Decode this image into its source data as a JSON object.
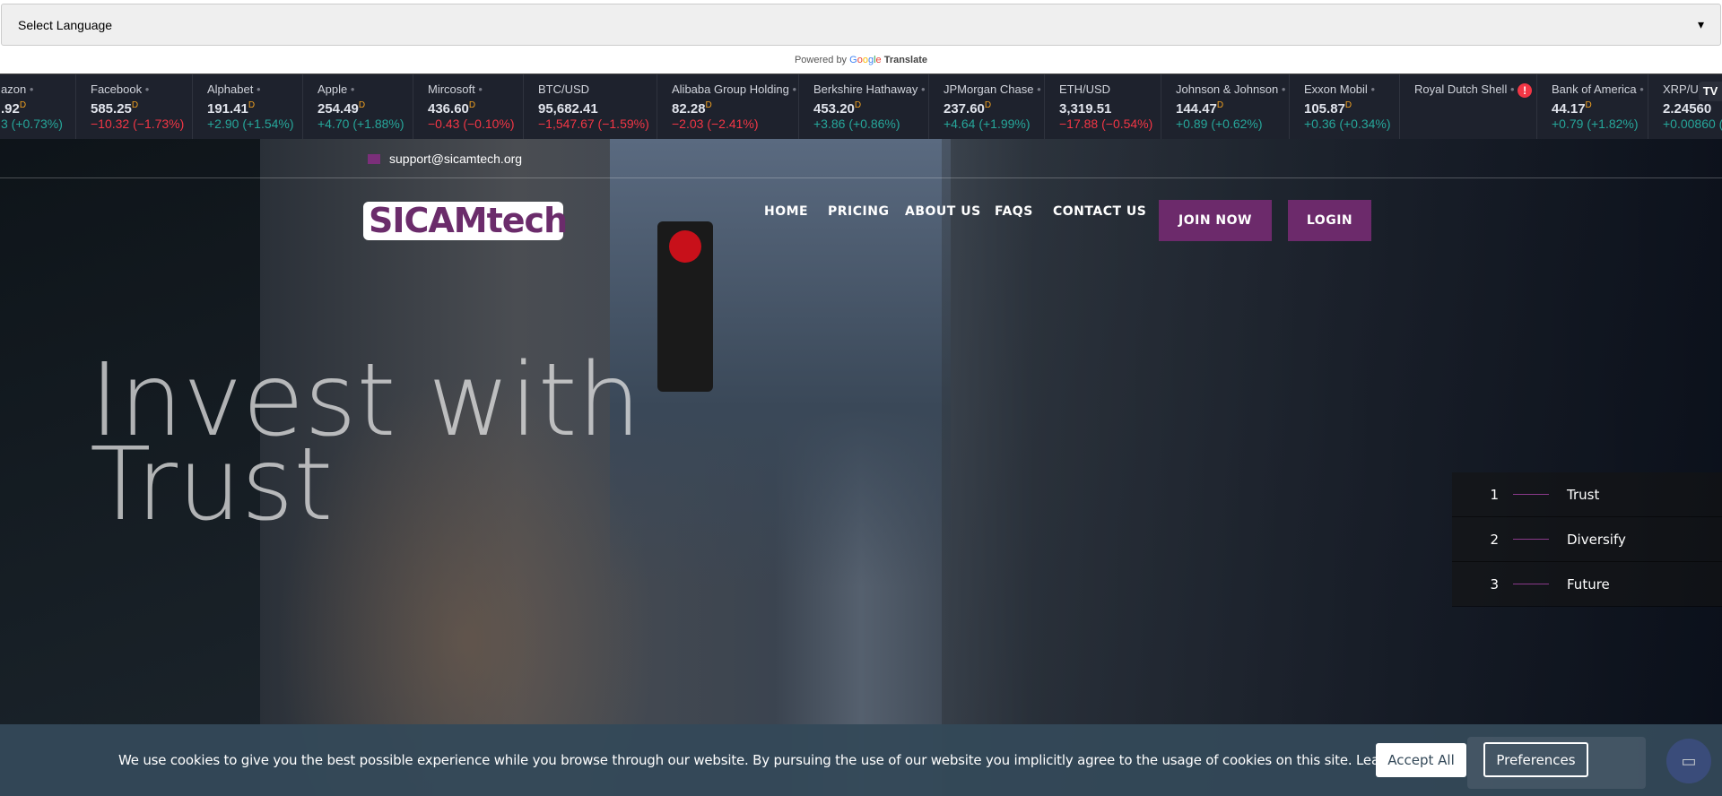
{
  "language_select": {
    "value": "Select Language"
  },
  "powered_by": {
    "prefix": "Powered by",
    "google": "Google",
    "translate": "Translate"
  },
  "ticker": [
    {
      "name": "azon",
      "price": ".92",
      "delayed": "D",
      "change": "3 (+0.73%)",
      "dir": "up",
      "dot": true
    },
    {
      "name": "Facebook",
      "price": "585.25",
      "delayed": "D",
      "change": "−10.32 (−1.73%)",
      "dir": "dn",
      "dot": true
    },
    {
      "name": "Alphabet",
      "price": "191.41",
      "delayed": "D",
      "change": "+2.90 (+1.54%)",
      "dir": "up",
      "dot": true
    },
    {
      "name": "Apple",
      "price": "254.49",
      "delayed": "D",
      "change": "+4.70 (+1.88%)",
      "dir": "up",
      "dot": true
    },
    {
      "name": "Mircosoft",
      "price": "436.60",
      "delayed": "D",
      "change": "−0.43 (−0.10%)",
      "dir": "dn",
      "dot": true
    },
    {
      "name": "BTC/USD",
      "price": "95,682.41",
      "delayed": "",
      "change": "−1,547.67 (−1.59%)",
      "dir": "dn",
      "dot": false
    },
    {
      "name": "Alibaba Group Holding",
      "price": "82.28",
      "delayed": "D",
      "change": "−2.03 (−2.41%)",
      "dir": "dn",
      "dot": true
    },
    {
      "name": "Berkshire Hathaway",
      "price": "453.20",
      "delayed": "D",
      "change": "+3.86 (+0.86%)",
      "dir": "up",
      "dot": true
    },
    {
      "name": "JPMorgan Chase",
      "price": "237.60",
      "delayed": "D",
      "change": "+4.64 (+1.99%)",
      "dir": "up",
      "dot": true
    },
    {
      "name": "ETH/USD",
      "price": "3,319.51",
      "delayed": "",
      "change": "−17.88 (−0.54%)",
      "dir": "dn",
      "dot": false
    },
    {
      "name": "Johnson & Johnson",
      "price": "144.47",
      "delayed": "D",
      "change": "+0.89 (+0.62%)",
      "dir": "up",
      "dot": true
    },
    {
      "name": "Exxon Mobil",
      "price": "105.87",
      "delayed": "D",
      "change": "+0.36 (+0.34%)",
      "dir": "up",
      "dot": true
    },
    {
      "name": "Royal Dutch Shell",
      "price": "",
      "delayed": "",
      "change": "",
      "dir": "up",
      "dot": true,
      "alert": "!"
    },
    {
      "name": "Bank of America",
      "price": "44.17",
      "delayed": "D",
      "change": "+0.79 (+1.82%)",
      "dir": "up",
      "dot": true
    },
    {
      "name": "XRP/USD",
      "price": "2.24560",
      "delayed": "",
      "change": "+0.00860 (+",
      "dir": "up",
      "dot": false
    }
  ],
  "ticker_logo": "TV",
  "colors": {
    "up": "#26a69a",
    "down": "#f23645",
    "brand": "#6c2a6b",
    "cookie_bg": "#344959"
  },
  "header": {
    "email": "support@sicamtech.org",
    "logo": "SICAMtech",
    "nav": [
      "HOME",
      "PRICING",
      "ABOUT US",
      "FAQS",
      "CONTACT US"
    ],
    "join": "JOIN NOW",
    "login": "LOGIN"
  },
  "hero": {
    "line1": "Invest with",
    "line2": "Trust"
  },
  "slides": [
    {
      "n": "1",
      "label": "Trust"
    },
    {
      "n": "2",
      "label": "Diversify"
    },
    {
      "n": "3",
      "label": "Future"
    }
  ],
  "cookie": {
    "text": "We use cookies to give you the best possible experience while you browse through our website. By pursuing the use of our website you implicitly agree to the usage of cookies on this site.",
    "learn_more": "Learn more",
    "accept": "Accept All",
    "preferences": "Preferences"
  }
}
